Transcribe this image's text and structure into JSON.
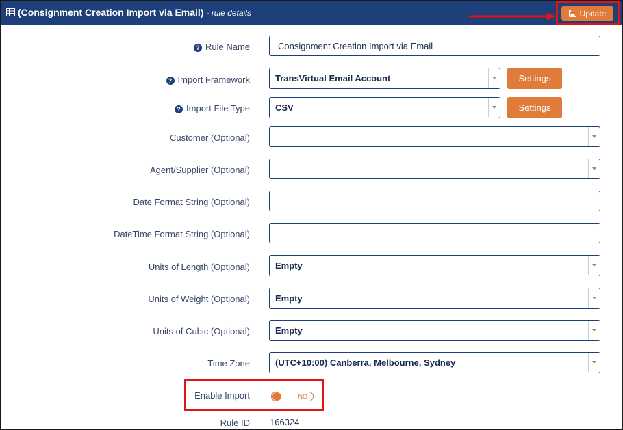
{
  "header": {
    "title": "(Consignment Creation Import via Email)",
    "subtitle": "- rule details",
    "update_label": "Update",
    "icons": [
      "grid-icon",
      "save-icon"
    ]
  },
  "form": {
    "rule_name": {
      "label": "Rule Name",
      "value": "Consignment Creation Import via Email"
    },
    "import_framework": {
      "label": "Import Framework",
      "value": "TransVirtual Email Account",
      "settings_label": "Settings"
    },
    "import_file_type": {
      "label": "Import File Type",
      "value": "CSV",
      "settings_label": "Settings"
    },
    "customer": {
      "label": "Customer (Optional)",
      "value": ""
    },
    "agent_supplier": {
      "label": "Agent/Supplier (Optional)",
      "value": ""
    },
    "date_format": {
      "label": "Date Format String (Optional)",
      "value": ""
    },
    "datetime_format": {
      "label": "DateTime Format String (Optional)",
      "value": ""
    },
    "units_length": {
      "label": "Units of Length (Optional)",
      "value": "Empty"
    },
    "units_weight": {
      "label": "Units of Weight (Optional)",
      "value": "Empty"
    },
    "units_cubic": {
      "label": "Units of Cubic (Optional)",
      "value": "Empty"
    },
    "time_zone": {
      "label": "Time Zone",
      "value": "(UTC+10:00) Canberra, Melbourne, Sydney"
    },
    "enable_import": {
      "label": "Enable Import",
      "state_text": "NO",
      "enabled": false
    },
    "rule_id": {
      "label": "Rule ID",
      "value": "166324"
    }
  },
  "colors": {
    "header_bg": "#1d3f7a",
    "accent": "#e07b39",
    "highlight": "#e01414"
  }
}
